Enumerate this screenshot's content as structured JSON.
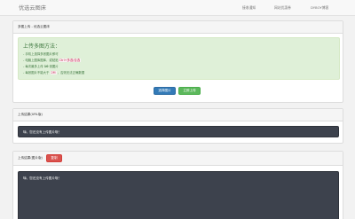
{
  "navbar": {
    "brand": "优选云图床",
    "links": [
      "接收通知",
      "网站优惠券",
      "DYBOY博客"
    ]
  },
  "upload_panel": {
    "heading": "多图上传 - 优选云图床",
    "alert_title": "上传多图方法：",
    "tips": {
      "tip1": "手机上选择多张图片即可",
      "tip2_before": "电脑上图库图库，或粘贴",
      "tip2_highlight": "Ctrl+多选/合选",
      "tip2_after": "",
      "tip3_before": "每次最多上传",
      "tip3_bold": "10",
      "tip3_after": "张图片",
      "tip4_before": "每张图片不能大于",
      "tip4_highlight": "2M",
      "tip4_after": "，否则无法正确数据"
    },
    "select_button": "选择图片",
    "upload_button": "立即上传"
  },
  "url_panel": {
    "heading": "上传结果(URL版)",
    "console_text": "嗨，您还没有上传图片哦！"
  },
  "html_panel": {
    "heading": "上传结果(图片版)",
    "copy_button": "复制",
    "console_text": "嗨，您还没有上传图片哦！"
  },
  "colors": {
    "primary": "#337ab7",
    "success": "#5cb85c",
    "danger": "#d9534f",
    "alert_bg": "#dff0d8",
    "console_bg": "#3d424d"
  }
}
